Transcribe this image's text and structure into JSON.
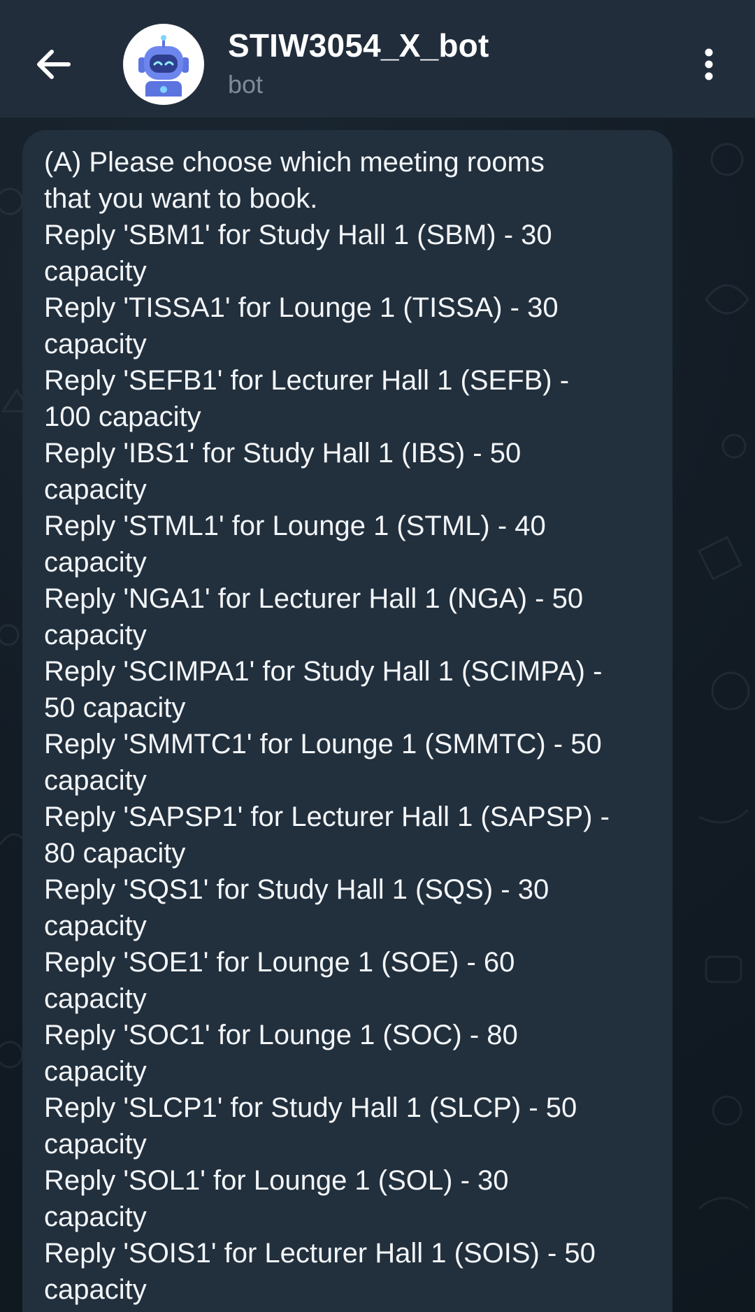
{
  "header": {
    "back_icon": "arrow-left-icon",
    "avatar_icon": "robot-avatar-icon",
    "title": "STIW3054_X_bot",
    "subtitle": "bot",
    "menu_icon": "more-vertical-icon"
  },
  "colors": {
    "header_bg": "#212d3b",
    "chat_bg": "#131c25",
    "bubble_bg": "#222f3d",
    "text_primary": "#f3f6f9",
    "text_secondary": "#7f8b98"
  },
  "message": {
    "lines": [
      "(A) Please choose which meeting rooms",
      "that you want to book.",
      "Reply 'SBM1' for Study Hall 1 (SBM) - 30",
      "capacity",
      "Reply 'TISSA1' for Lounge 1 (TISSA) - 30",
      "capacity",
      "Reply 'SEFB1' for Lecturer Hall 1 (SEFB) -",
      "100 capacity",
      "Reply 'IBS1' for Study Hall 1 (IBS) - 50",
      "capacity",
      "Reply 'STML1' for Lounge 1 (STML) - 40",
      "capacity",
      "Reply 'NGA1' for Lecturer Hall 1 (NGA) - 50",
      "capacity",
      "Reply 'SCIMPA1' for Study Hall 1 (SCIMPA) -",
      "50 capacity",
      "Reply 'SMMTC1' for Lounge 1 (SMMTC) - 50",
      "capacity",
      "Reply 'SAPSP1' for Lecturer Hall 1 (SAPSP) -",
      "80 capacity",
      "Reply 'SQS1' for Study Hall 1 (SQS) - 30",
      "capacity",
      "Reply 'SOE1' for Lounge 1 (SOE) - 60",
      "capacity",
      "Reply 'SOC1' for Lounge 1 (SOC) - 80",
      "capacity",
      "Reply 'SLCP1' for Study Hall 1 (SLCP) - 50",
      "capacity",
      "Reply 'SOL1' for Lounge 1 (SOL) - 30",
      "capacity",
      "Reply 'SOIS1' for Lecturer Hall 1 (SOIS) - 50",
      "capacity"
    ]
  }
}
